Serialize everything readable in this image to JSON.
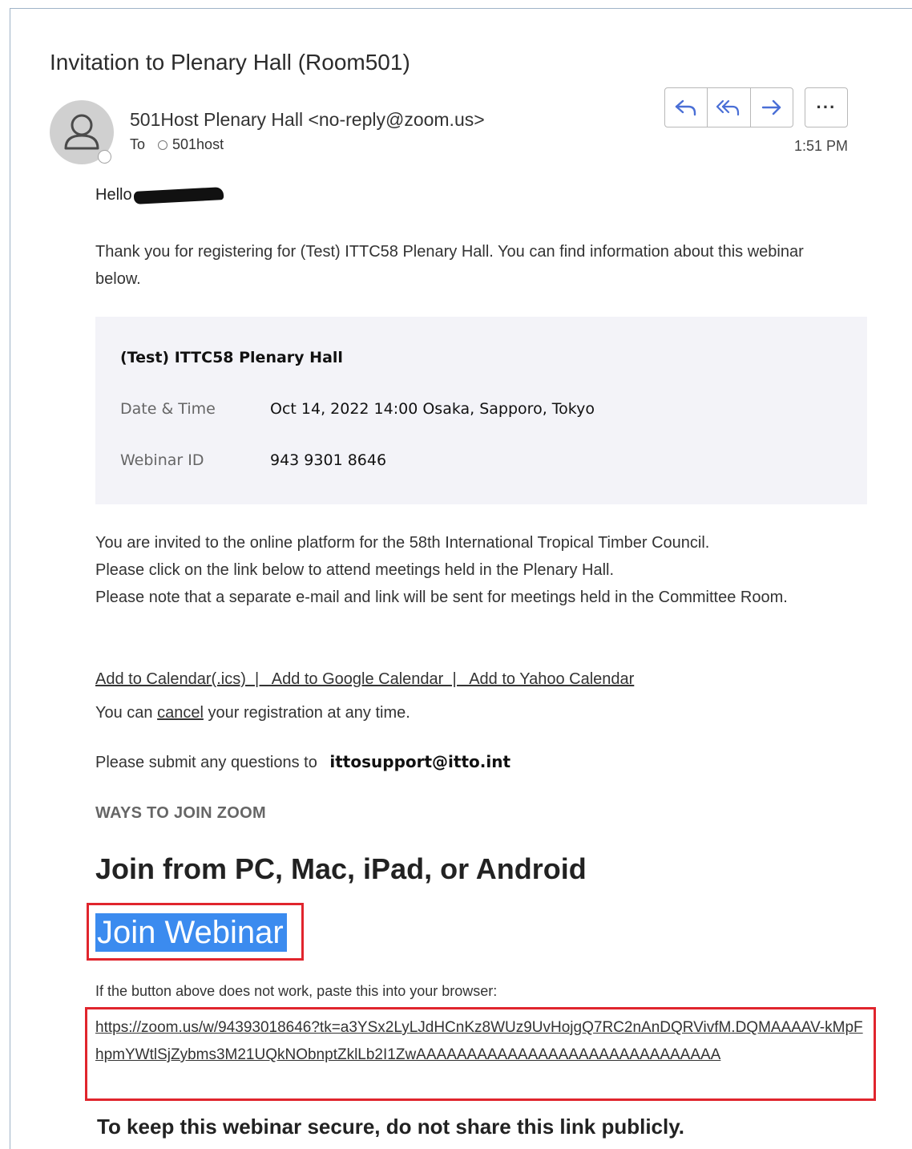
{
  "email": {
    "subject": "Invitation to Plenary Hall (Room501)",
    "sender": "501Host Plenary Hall <no-reply@zoom.us>",
    "to_label": "To",
    "recipient": "501host",
    "time": "1:51 PM",
    "more_label": "···",
    "actions": [
      "reply-icon",
      "reply-all-icon",
      "forward-icon",
      "more-icon"
    ]
  },
  "body": {
    "greeting": "Hello",
    "thanks": "Thank you for registering for (Test) ITTC58 Plenary Hall. You can find information about this webinar below.",
    "info": {
      "title": "(Test) ITTC58 Plenary Hall",
      "date_label": "Date & Time",
      "date_value": "Oct 14, 2022 14:00 Osaka, Sapporo, Tokyo",
      "id_label": "Webinar ID",
      "id_value": "943 9301 8646"
    },
    "invite_line1": "You are invited to the online platform for the 58th International Tropical Timber Council.",
    "invite_line2": "Please click on the link below to attend meetings held in the Plenary Hall.",
    "invite_line3": "Please note that a separate e-mail and link will be sent for meetings held in the Committee Room.",
    "calendar_links": "Add to Calendar(.ics)  |   Add to Google Calendar  |   Add to Yahoo Calendar",
    "cancel_prefix": "You can ",
    "cancel_link": "cancel",
    "cancel_suffix": " your registration at any time.",
    "questions_prefix": "Please submit any questions to",
    "questions_email": "ittosupport@itto.int",
    "ways_heading": "WAYS TO JOIN ZOOM",
    "join_heading": "Join from PC, Mac, iPad, or Android",
    "join_button": "Join Webinar",
    "paste_note": "If the button above does not work, paste this into your browser:",
    "join_url": "https://zoom.us/w/94393018646?tk=a3YSx2LyLJdHCnKz8WUz9UvHojgQ7RC2nAnDQRVivfM.DQMAAAAV-kMpFhpmYWtlSjZybms3M21UQkNObnptZklLb2I1ZwAAAAAAAAAAAAAAAAAAAAAAAAAAAAAA",
    "secure_note": "To keep this webinar secure, do not share this link publicly."
  },
  "colors": {
    "highlight_border": "#e0252d",
    "join_button_bg": "#3b8bef",
    "action_icon": "#4a6fd6",
    "info_box_bg": "#f3f3f8"
  }
}
